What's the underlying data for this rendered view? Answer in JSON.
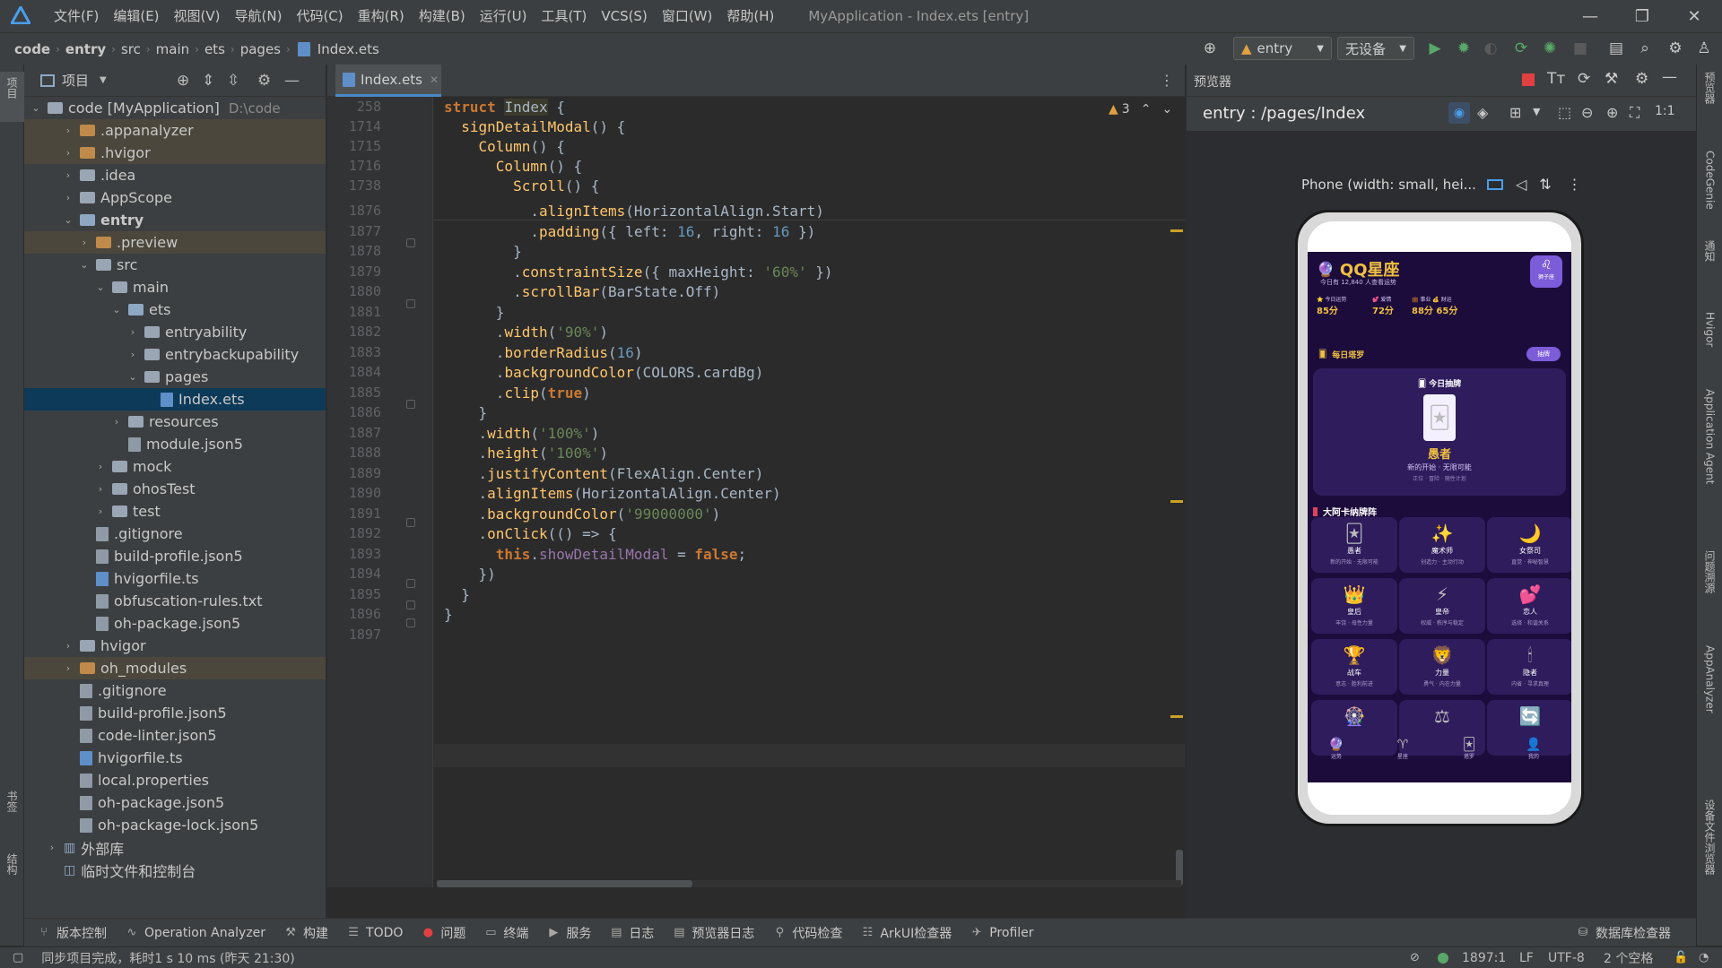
{
  "menubar": {
    "items": [
      "文件(F)",
      "编辑(E)",
      "视图(V)",
      "导航(N)",
      "代码(C)",
      "重构(R)",
      "构建(B)",
      "运行(U)",
      "工具(T)",
      "VCS(S)",
      "窗口(W)",
      "帮助(H)"
    ],
    "title": "MyApplication - Index.ets [entry]"
  },
  "breadcrumb": {
    "items": [
      "code",
      "entry",
      "src",
      "main",
      "ets",
      "pages"
    ],
    "file": "Index.ets"
  },
  "toolbar": {
    "module": "entry",
    "device": "无设备"
  },
  "left_strip": {
    "top": "项目",
    "bottom1": "书签",
    "bottom2": "结构"
  },
  "project_panel": {
    "title": "项目",
    "root_name": "code [MyApplication]",
    "root_path": "D:\\code",
    "rows": [
      {
        "label": ".appanalyzer",
        "indent": 2,
        "type": "folder-orange",
        "arrow": "›",
        "hl": true
      },
      {
        "label": ".hvigor",
        "indent": 2,
        "type": "folder-orange",
        "arrow": "›",
        "hl": true
      },
      {
        "label": ".idea",
        "indent": 2,
        "type": "folder-gray",
        "arrow": "›"
      },
      {
        "label": "AppScope",
        "indent": 2,
        "type": "folder-gray",
        "arrow": "›"
      },
      {
        "label": "entry",
        "indent": 2,
        "type": "folder-blue",
        "arrow": "⌄",
        "bold": true
      },
      {
        "label": ".preview",
        "indent": 3,
        "type": "folder-orange",
        "arrow": "›",
        "hl": true
      },
      {
        "label": "src",
        "indent": 3,
        "type": "folder-gray",
        "arrow": "⌄"
      },
      {
        "label": "main",
        "indent": 4,
        "type": "folder-gray",
        "arrow": "⌄"
      },
      {
        "label": "ets",
        "indent": 5,
        "type": "folder-blue",
        "arrow": "⌄"
      },
      {
        "label": "entryability",
        "indent": 6,
        "type": "folder-gray",
        "arrow": "›"
      },
      {
        "label": "entrybackupability",
        "indent": 6,
        "type": "folder-gray",
        "arrow": "›"
      },
      {
        "label": "pages",
        "indent": 6,
        "type": "folder-gray",
        "arrow": "⌄"
      },
      {
        "label": "Index.ets",
        "indent": 7,
        "type": "file-ts",
        "arrow": "",
        "sel": true
      },
      {
        "label": "resources",
        "indent": 5,
        "type": "folder-gray",
        "arrow": "›"
      },
      {
        "label": "module.json5",
        "indent": 5,
        "type": "file",
        "arrow": ""
      },
      {
        "label": "mock",
        "indent": 4,
        "type": "folder-gray",
        "arrow": "›"
      },
      {
        "label": "ohosTest",
        "indent": 4,
        "type": "folder-gray",
        "arrow": "›"
      },
      {
        "label": "test",
        "indent": 4,
        "type": "folder-gray",
        "arrow": "›"
      },
      {
        "label": ".gitignore",
        "indent": 3,
        "type": "file",
        "arrow": ""
      },
      {
        "label": "build-profile.json5",
        "indent": 3,
        "type": "file",
        "arrow": ""
      },
      {
        "label": "hvigorfile.ts",
        "indent": 3,
        "type": "file-ts",
        "arrow": ""
      },
      {
        "label": "obfuscation-rules.txt",
        "indent": 3,
        "type": "file",
        "arrow": ""
      },
      {
        "label": "oh-package.json5",
        "indent": 3,
        "type": "file",
        "arrow": ""
      },
      {
        "label": "hvigor",
        "indent": 2,
        "type": "folder-gray",
        "arrow": "›"
      },
      {
        "label": "oh_modules",
        "indent": 2,
        "type": "folder-orange",
        "arrow": "›",
        "hl": true
      },
      {
        "label": ".gitignore",
        "indent": 2,
        "type": "file",
        "arrow": ""
      },
      {
        "label": "build-profile.json5",
        "indent": 2,
        "type": "file",
        "arrow": ""
      },
      {
        "label": "code-linter.json5",
        "indent": 2,
        "type": "file",
        "arrow": ""
      },
      {
        "label": "hvigorfile.ts",
        "indent": 2,
        "type": "file-ts",
        "arrow": ""
      },
      {
        "label": "local.properties",
        "indent": 2,
        "type": "file",
        "arrow": ""
      },
      {
        "label": "oh-package.json5",
        "indent": 2,
        "type": "file",
        "arrow": ""
      },
      {
        "label": "oh-package-lock.json5",
        "indent": 2,
        "type": "file",
        "arrow": ""
      },
      {
        "label": "外部库",
        "indent": 1,
        "type": "lib",
        "arrow": "›"
      },
      {
        "label": "临时文件和控制台",
        "indent": 1,
        "type": "scratch",
        "arrow": ""
      }
    ]
  },
  "editor": {
    "tab": "Index.ets",
    "warnings": "3",
    "sticky": [
      {
        "ln": "258",
        "code": [
          [
            "kw",
            "struct "
          ],
          [
            "hlcls",
            "Index"
          ],
          [
            "cls",
            " {"
          ]
        ]
      },
      {
        "ln": "1714",
        "code": [
          [
            "cls",
            "  "
          ],
          [
            "fn",
            "signDetailModal"
          ],
          [
            "cls",
            "() {"
          ]
        ]
      },
      {
        "ln": "1715",
        "code": [
          [
            "cls",
            "    "
          ],
          [
            "fn",
            "Column"
          ],
          [
            "cls",
            "() {"
          ]
        ]
      },
      {
        "ln": "1716",
        "code": [
          [
            "cls",
            "      "
          ],
          [
            "fn",
            "Column"
          ],
          [
            "cls",
            "() {"
          ]
        ]
      },
      {
        "ln": "1738",
        "code": [
          [
            "cls",
            "        "
          ],
          [
            "fn",
            "Scroll"
          ],
          [
            "cls",
            "() {"
          ]
        ]
      }
    ],
    "lines": [
      {
        "ln": "1876",
        "code": [
          [
            "cls",
            "          ."
          ],
          [
            "fn",
            "alignItems"
          ],
          [
            "cls",
            "(HorizontalAlign.Start)"
          ]
        ]
      },
      {
        "ln": "1877",
        "code": [
          [
            "cls",
            "          ."
          ],
          [
            "fn",
            "padding"
          ],
          [
            "cls",
            "({ left: "
          ],
          [
            "nm",
            "16"
          ],
          [
            "cls",
            ", right: "
          ],
          [
            "nm",
            "16"
          ],
          [
            "cls",
            " })"
          ]
        ]
      },
      {
        "ln": "1878",
        "code": [
          [
            "cls",
            "        }"
          ]
        ]
      },
      {
        "ln": "1879",
        "code": [
          [
            "cls",
            "        ."
          ],
          [
            "fn",
            "constraintSize"
          ],
          [
            "cls",
            "({ maxHeight: "
          ],
          [
            "st",
            "'60%'"
          ],
          [
            "cls",
            " })"
          ]
        ]
      },
      {
        "ln": "1880",
        "code": [
          [
            "cls",
            "        ."
          ],
          [
            "fn",
            "scrollBar"
          ],
          [
            "cls",
            "(BarState.Off)"
          ]
        ]
      },
      {
        "ln": "1881",
        "code": [
          [
            "cls",
            "      }"
          ]
        ]
      },
      {
        "ln": "1882",
        "code": [
          [
            "cls",
            "      ."
          ],
          [
            "fn",
            "width"
          ],
          [
            "cls",
            "("
          ],
          [
            "st",
            "'90%'"
          ],
          [
            "cls",
            ")"
          ]
        ]
      },
      {
        "ln": "1883",
        "code": [
          [
            "cls",
            "      ."
          ],
          [
            "fn",
            "borderRadius"
          ],
          [
            "cls",
            "("
          ],
          [
            "nm",
            "16"
          ],
          [
            "cls",
            ")"
          ]
        ]
      },
      {
        "ln": "1884",
        "code": [
          [
            "cls",
            "      ."
          ],
          [
            "fn",
            "backgroundColor"
          ],
          [
            "cls",
            "(COLORS.cardBg)"
          ]
        ]
      },
      {
        "ln": "1885",
        "code": [
          [
            "cls",
            "      ."
          ],
          [
            "fn",
            "clip"
          ],
          [
            "cls",
            "("
          ],
          [
            "kw",
            "true"
          ],
          [
            "cls",
            ")"
          ]
        ]
      },
      {
        "ln": "1886",
        "code": [
          [
            "cls",
            "    }"
          ]
        ]
      },
      {
        "ln": "1887",
        "code": [
          [
            "cls",
            "    ."
          ],
          [
            "fn",
            "width"
          ],
          [
            "cls",
            "("
          ],
          [
            "st",
            "'100%'"
          ],
          [
            "cls",
            ")"
          ]
        ]
      },
      {
        "ln": "1888",
        "code": [
          [
            "cls",
            "    ."
          ],
          [
            "fn",
            "height"
          ],
          [
            "cls",
            "("
          ],
          [
            "st",
            "'100%'"
          ],
          [
            "cls",
            ")"
          ]
        ]
      },
      {
        "ln": "1889",
        "code": [
          [
            "cls",
            "    ."
          ],
          [
            "fn",
            "justifyContent"
          ],
          [
            "cls",
            "(FlexAlign.Center)"
          ]
        ]
      },
      {
        "ln": "1890",
        "code": [
          [
            "cls",
            "    ."
          ],
          [
            "fn",
            "alignItems"
          ],
          [
            "cls",
            "(HorizontalAlign.Center)"
          ]
        ]
      },
      {
        "ln": "1891",
        "code": [
          [
            "cls",
            "    ."
          ],
          [
            "fn",
            "backgroundColor"
          ],
          [
            "cls",
            "("
          ],
          [
            "st",
            "'99000000'"
          ],
          [
            "cls",
            ")"
          ]
        ]
      },
      {
        "ln": "1892",
        "code": [
          [
            "cls",
            "    ."
          ],
          [
            "fn",
            "onClick"
          ],
          [
            "cls",
            "(() => {"
          ]
        ]
      },
      {
        "ln": "1893",
        "code": [
          [
            "cls",
            "      "
          ],
          [
            "kw",
            "this"
          ],
          [
            "cls",
            "."
          ],
          [
            "pr",
            "showDetailModal"
          ],
          [
            "cls",
            " = "
          ],
          [
            "kw",
            "false"
          ],
          [
            "cls",
            ";"
          ]
        ]
      },
      {
        "ln": "1894",
        "code": [
          [
            "cls",
            "    })"
          ]
        ]
      },
      {
        "ln": "1895",
        "code": [
          [
            "cls",
            "  }"
          ]
        ]
      },
      {
        "ln": "1896",
        "code": [
          [
            "cls",
            "}"
          ]
        ]
      },
      {
        "ln": "1897",
        "code": [
          [
            "cls",
            ""
          ]
        ]
      }
    ]
  },
  "previewer": {
    "title": "预览器",
    "route": "entry : /pages/Index",
    "device_label": "Phone (width: small, hei..."
  },
  "app": {
    "title": "QQ星座",
    "subtitle": "今日有 12,840 人查看运势",
    "badge": "狮子座",
    "stats": [
      {
        "label": "⭐ 今日运势",
        "value": "85分"
      },
      {
        "label": "💕 爱情",
        "value": "72分"
      },
      {
        "label": "💼 事业 💰 财运",
        "value": "88分 65分"
      }
    ],
    "section_tarot": "每日塔罗",
    "draw_btn": "抽牌",
    "today_draw": "今日抽牌",
    "card_name": "愚者",
    "card_desc": "新的开始 · 无限可能",
    "card_sub": "正位 · 冒险 · 随性计划",
    "arcana_title": "大阿卡纳牌阵",
    "arcana": [
      {
        "icon": "🃏",
        "name": "愚者",
        "sub": "新的开始 · 无限可能"
      },
      {
        "icon": "✨",
        "name": "魔术师",
        "sub": "创造力 · 主动行动"
      },
      {
        "icon": "🌙",
        "name": "女祭司",
        "sub": "直觉 · 神秘智慧"
      },
      {
        "icon": "👑",
        "name": "皇后",
        "sub": "丰饶 · 母性力量"
      },
      {
        "icon": "⚡",
        "name": "皇帝",
        "sub": "权威 · 秩序与稳定"
      },
      {
        "icon": "💕",
        "name": "恋人",
        "sub": "选择 · 和谐关系"
      },
      {
        "icon": "🏆",
        "name": "战车",
        "sub": "意志 · 胜利前进"
      },
      {
        "icon": "🦁",
        "name": "力量",
        "sub": "勇气 · 内在力量"
      },
      {
        "icon": "🕯",
        "name": "隐者",
        "sub": "内省 · 寻求真理"
      },
      {
        "icon": "🎡",
        "name": "",
        "sub": ""
      },
      {
        "icon": "⚖",
        "name": "",
        "sub": ""
      },
      {
        "icon": "🔄",
        "name": "",
        "sub": ""
      }
    ],
    "nav": [
      {
        "icon": "🔮",
        "label": "运势"
      },
      {
        "icon": "♈",
        "label": "星座"
      },
      {
        "icon": "🃏",
        "label": "塔罗"
      },
      {
        "icon": "👤",
        "label": "我的"
      }
    ]
  },
  "right_strip": [
    "预览器",
    "CodeGenie",
    "通知",
    "Hvigor",
    "Application Agent",
    "问题溯源",
    "AppAnalyzer",
    "设备文件浏览器"
  ],
  "bottom_tools": [
    "版本控制",
    "Operation Analyzer",
    "构建",
    "TODO",
    "问题",
    "终端",
    "服务",
    "日志",
    "预览器日志",
    "代码检查",
    "ArkUI检查器",
    "Profiler"
  ],
  "bottom_right": "数据库检查器",
  "status": {
    "message": "同步项目完成，耗时1 s 10 ms (昨天 21:30)",
    "position": "1897:1",
    "eol": "LF",
    "encoding": "UTF-8",
    "indent": "2 个空格"
  }
}
